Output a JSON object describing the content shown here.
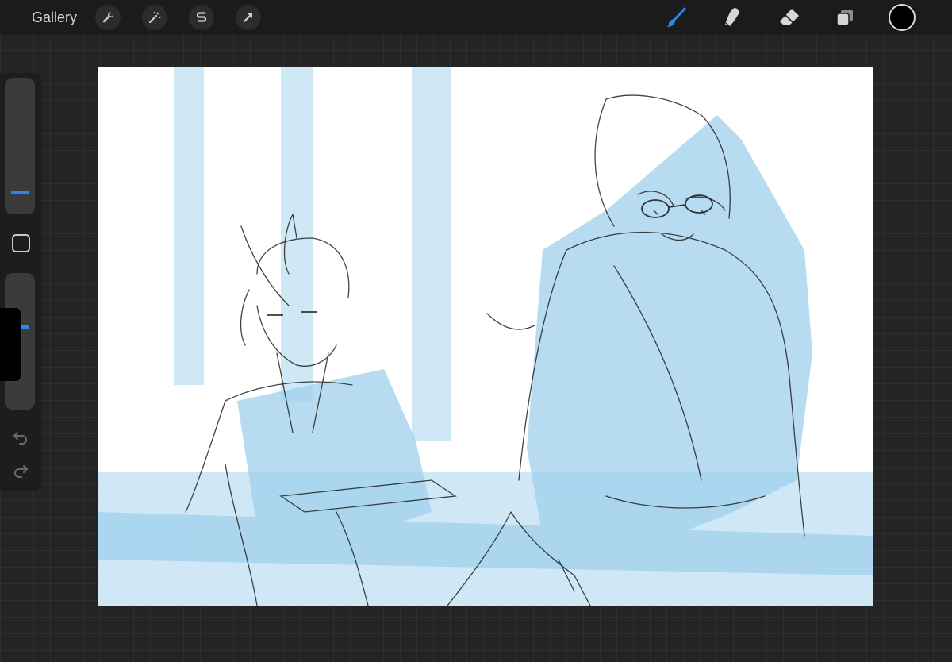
{
  "toolbar": {
    "gallery_label": "Gallery",
    "left_tools": [
      "wrench-icon",
      "magic-wand-icon",
      "selection-icon",
      "transform-arrow-icon"
    ],
    "right_tools": [
      "brush-icon",
      "smudge-icon",
      "eraser-icon",
      "layers-icon"
    ],
    "active_tool": "brush",
    "active_color": "#2e86f1",
    "current_color": "#000000"
  },
  "sidebar": {
    "brush_size_level": 0.18,
    "brush_opacity_level": 0.6,
    "buttons": [
      "modify-square-icon",
      "undo-icon",
      "redo-icon"
    ]
  },
  "canvas": {
    "wash_color": "#a9d6ee",
    "line_color": "#222222"
  }
}
